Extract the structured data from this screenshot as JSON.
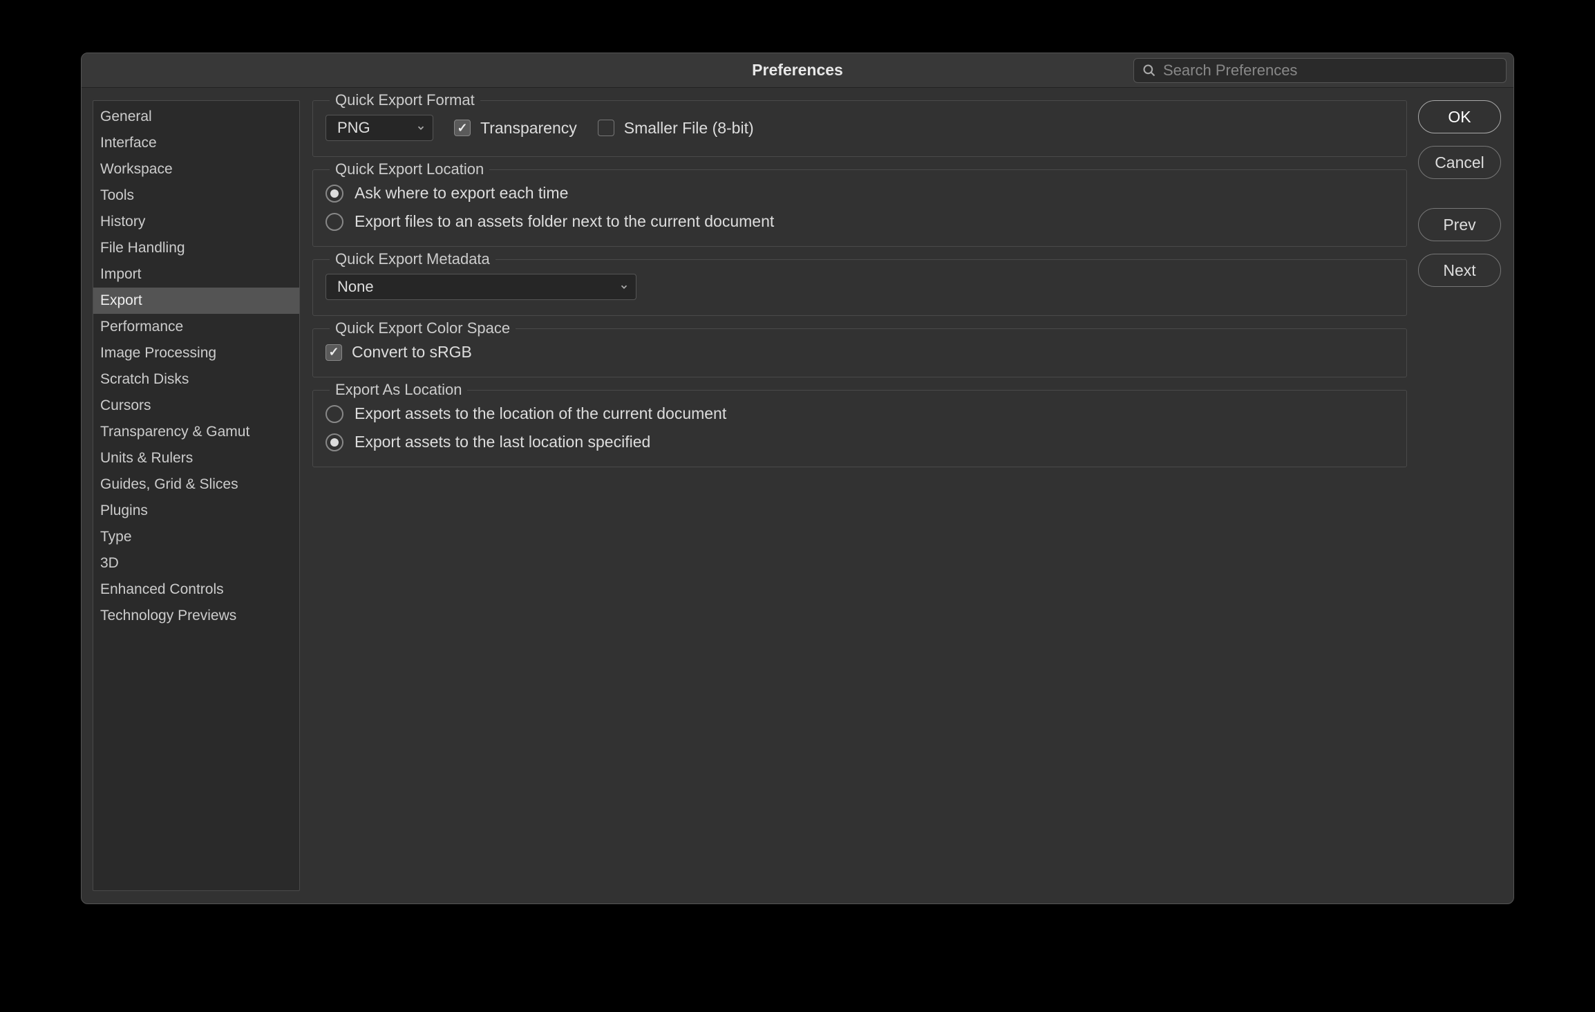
{
  "dialog": {
    "title": "Preferences",
    "search_placeholder": "Search Preferences"
  },
  "sidebar": {
    "selected_index": 7,
    "items": [
      {
        "label": "General"
      },
      {
        "label": "Interface"
      },
      {
        "label": "Workspace"
      },
      {
        "label": "Tools"
      },
      {
        "label": "History"
      },
      {
        "label": "File Handling"
      },
      {
        "label": "Import"
      },
      {
        "label": "Export"
      },
      {
        "label": "Performance"
      },
      {
        "label": "Image Processing"
      },
      {
        "label": "Scratch Disks"
      },
      {
        "label": "Cursors"
      },
      {
        "label": "Transparency & Gamut"
      },
      {
        "label": "Units & Rulers"
      },
      {
        "label": "Guides, Grid & Slices"
      },
      {
        "label": "Plugins"
      },
      {
        "label": "Type"
      },
      {
        "label": "3D"
      },
      {
        "label": "Enhanced Controls"
      },
      {
        "label": "Technology Previews"
      }
    ]
  },
  "panels": {
    "quick_export_format": {
      "legend": "Quick Export Format",
      "format_value": "PNG",
      "transparency_label": "Transparency",
      "transparency_checked": true,
      "smaller_file_label": "Smaller File (8-bit)",
      "smaller_file_checked": false
    },
    "quick_export_location": {
      "legend": "Quick Export Location",
      "option1_label": "Ask where to export each time",
      "option2_label": "Export files to an assets folder next to the current document",
      "selected": "option1"
    },
    "quick_export_metadata": {
      "legend": "Quick Export Metadata",
      "value": "None"
    },
    "quick_export_color_space": {
      "legend": "Quick Export Color Space",
      "convert_srgb_label": "Convert to sRGB",
      "convert_srgb_checked": true
    },
    "export_as_location": {
      "legend": "Export As Location",
      "option1_label": "Export assets to the location of the current document",
      "option2_label": "Export assets to the last location specified",
      "selected": "option2"
    }
  },
  "buttons": {
    "ok": "OK",
    "cancel": "Cancel",
    "prev": "Prev",
    "next": "Next"
  }
}
